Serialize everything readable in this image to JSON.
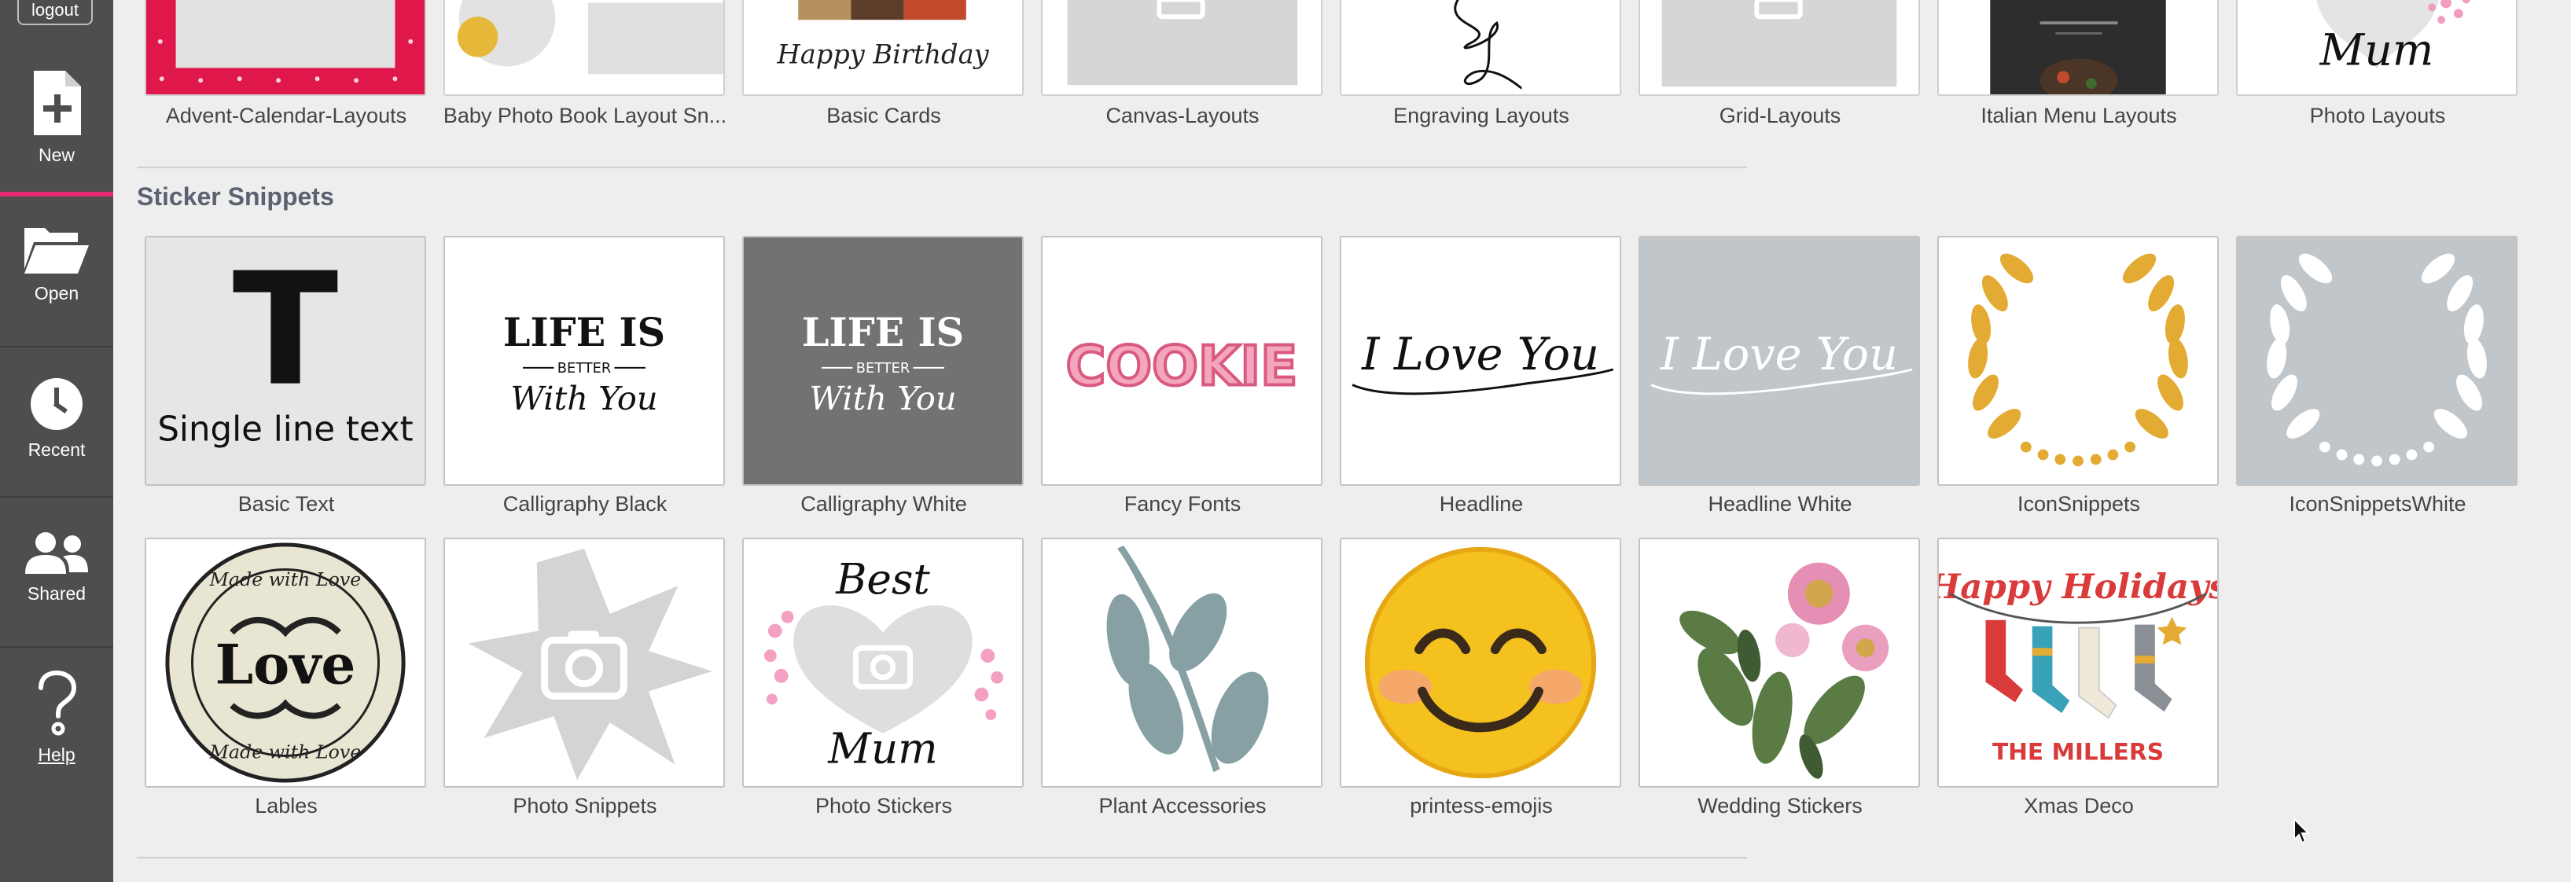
{
  "sidebar": {
    "logout": "logout",
    "new": "New",
    "open": "Open",
    "recent": "Recent",
    "shared": "Shared",
    "help": "Help"
  },
  "top_row": [
    "Advent-Calendar-Layouts",
    "Baby Photo Book Layout Sn...",
    "Basic Cards",
    "Canvas-Layouts",
    "Engraving Layouts",
    "Grid-Layouts",
    "Italian Menu Layouts",
    "Photo Layouts"
  ],
  "top_thumb_text": {
    "happy_birthday": "Happy Birthday",
    "mum": "Mum"
  },
  "sticker_section": {
    "title": "Sticker Snippets",
    "row1": [
      "Basic Text",
      "Calligraphy Black",
      "Calligraphy White",
      "Fancy Fonts",
      "Headline",
      "Headline White",
      "IconSnippets",
      "IconSnippetsWhite"
    ],
    "row2": [
      "Lables",
      "Photo Snippets",
      "Photo Stickers",
      "Plant Accessories",
      "printess-emojis",
      "Wedding Stickers",
      "Xmas Deco"
    ]
  },
  "thumb_text": {
    "basic_t": "T",
    "single_line": "Single line text",
    "life_is": "LIFE IS",
    "better": "BETTER",
    "with_you": "With You",
    "cookie": "COOKIE",
    "i_love_you": "I Love You",
    "made_with_love": "Made with Love",
    "love": "Love",
    "best": "Best",
    "mum": "Mum",
    "happy_holidays": "Happy Holidays",
    "the_millers": "THE MILLERS"
  },
  "colors": {
    "accent": "#e6296f",
    "sidebar": "#4e4e4e",
    "background": "#eeeeee",
    "gold": "#e3ab34",
    "leaf": "#86a0a3"
  }
}
